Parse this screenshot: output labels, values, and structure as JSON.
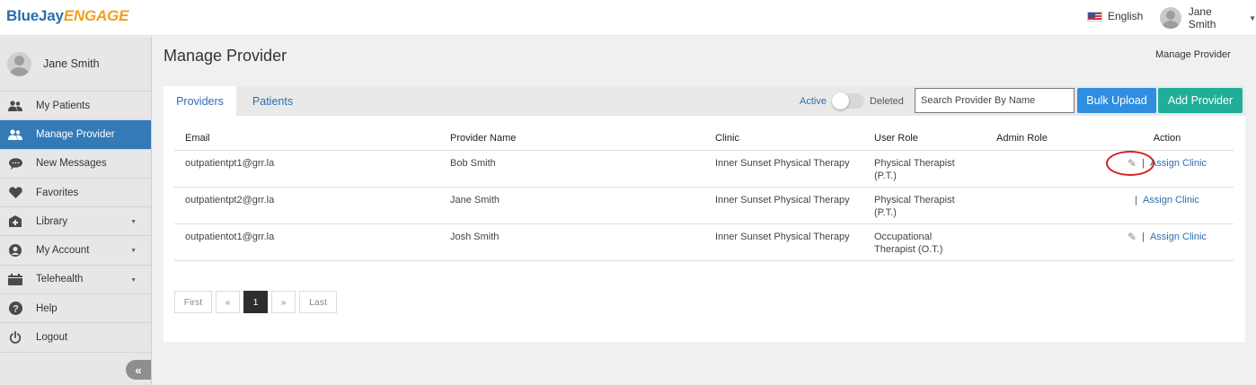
{
  "header": {
    "logo_part1": "BlueJay",
    "logo_part2": "ENGAGE",
    "language": "English",
    "user_name": "Jane Smith"
  },
  "sidebar": {
    "profile_name": "Jane Smith",
    "items": [
      {
        "label": "My Patients",
        "icon": "patients-icon"
      },
      {
        "label": "Manage Provider",
        "icon": "provider-icon",
        "active": true
      },
      {
        "label": "New Messages",
        "icon": "message-icon"
      },
      {
        "label": "Favorites",
        "icon": "heart-icon"
      },
      {
        "label": "Library",
        "icon": "library-icon",
        "has_caret": true
      },
      {
        "label": "My Account",
        "icon": "account-icon",
        "has_caret": true
      },
      {
        "label": "Telehealth",
        "icon": "telehealth-icon",
        "has_caret": true
      },
      {
        "label": "Help",
        "icon": "help-icon"
      },
      {
        "label": "Logout",
        "icon": "power-icon"
      }
    ],
    "collapse_glyph": "«"
  },
  "main": {
    "title": "Manage Provider",
    "breadcrumb": "Manage Provider",
    "tabs": [
      "Providers",
      "Patients"
    ],
    "toggle": {
      "active_label": "Active",
      "deleted_label": "Deleted",
      "state": "active"
    },
    "search_placeholder": "Search Provider By Name",
    "bulk_upload_label": "Bulk Upload",
    "add_provider_label": "Add Provider",
    "accent_color": "#2e8ee0",
    "add_color": "#1fae9a",
    "table": {
      "columns": [
        "Email",
        "Provider Name",
        "Clinic",
        "User Role",
        "Admin Role",
        "Action"
      ],
      "rows": [
        {
          "email": "outpatientpt1@grr.la",
          "name": "Bob Smith",
          "clinic": "Inner Sunset Physical Therapy",
          "role_line1": "Physical Therapist",
          "role_line2": "(P.T.)",
          "admin_role": "",
          "sep": "|",
          "assign": "Assign Clinic",
          "has_edit": true
        },
        {
          "email": "outpatientpt2@grr.la",
          "name": "Jane Smith",
          "clinic": "Inner Sunset Physical Therapy",
          "role_line1": "Physical Therapist",
          "role_line2": "(P.T.)",
          "admin_role": "",
          "sep": "|",
          "assign": "Assign Clinic",
          "has_edit": false
        },
        {
          "email": "outpatientot1@grr.la",
          "name": "Josh Smith",
          "clinic": "Inner Sunset Physical Therapy",
          "role_line1": "Occupational",
          "role_line2": "Therapist (O.T.)",
          "admin_role": "",
          "sep": "|",
          "assign": "Assign Clinic",
          "has_edit": true
        }
      ]
    },
    "pagination": {
      "first": "First",
      "prev": "«",
      "current": "1",
      "next": "»",
      "last": "Last"
    }
  }
}
